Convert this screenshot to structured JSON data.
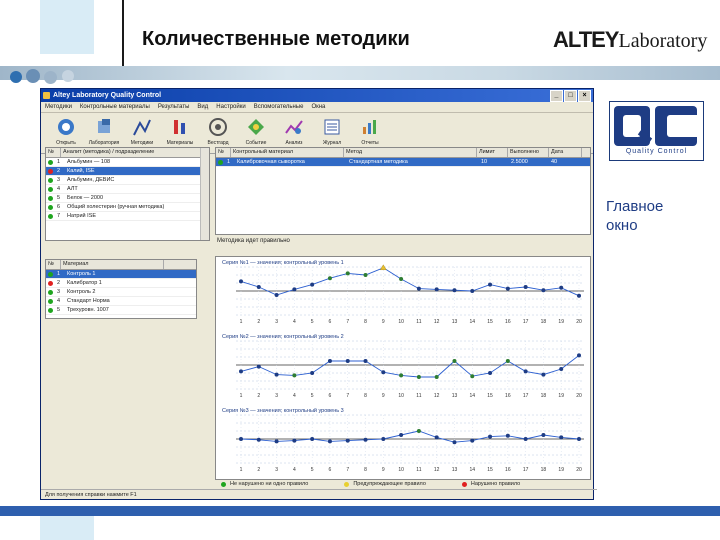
{
  "slide": {
    "title": "Количественные методики",
    "logo": {
      "main": "ALTEY",
      "sub": "Laboratory"
    },
    "side_label": [
      "Главное",
      "окно"
    ],
    "qc_badge": {
      "letters": "QC",
      "caption": "Quality Control"
    }
  },
  "window": {
    "title": "Altey Laboratory Quality Control",
    "menu": [
      "Методики",
      "Контрольные материалы",
      "Результаты",
      "Вид",
      "Настройки",
      "Вспомогательные",
      "Окна"
    ],
    "toolbar": [
      {
        "label": "Открыть",
        "icon": "open-icon"
      },
      {
        "label": "Лаборатория",
        "icon": "lab-icon"
      },
      {
        "label": "Методики",
        "icon": "method-icon"
      },
      {
        "label": "Материалы",
        "icon": "materials-icon"
      },
      {
        "label": "Вестгард",
        "icon": "westgard-icon"
      },
      {
        "label": "Событие",
        "icon": "event-icon"
      },
      {
        "label": "Анализ",
        "icon": "analysis-icon"
      },
      {
        "label": "Журнал",
        "icon": "journal-icon"
      },
      {
        "label": "Отчеты",
        "icon": "report-icon"
      }
    ]
  },
  "methods_table": {
    "headers": [
      "№",
      "Аналит (методика) / подразделение"
    ],
    "rows": [
      {
        "n": "1",
        "name": "Альбумин — 108",
        "status": "#1fa51f"
      },
      {
        "n": "2",
        "name": "Калий, ISE",
        "status": "#e02020",
        "selected": true
      },
      {
        "n": "3",
        "name": "Альбумин, ДЕВИС",
        "status": "#1fa51f"
      },
      {
        "n": "4",
        "name": "АЛТ",
        "status": "#1fa51f"
      },
      {
        "n": "5",
        "name": "Белок — 2000",
        "status": "#1fa51f"
      },
      {
        "n": "6",
        "name": "Общий холестерин (ручная методика)",
        "status": "#1fa51f"
      },
      {
        "n": "7",
        "name": "Натрий ISE",
        "status": "#1fa51f"
      }
    ]
  },
  "materials_table": {
    "headers": [
      "№",
      "Материал",
      ""
    ],
    "rows": [
      {
        "n": "1",
        "name": "Контроль 1",
        "status": "#1fa51f",
        "selected": true
      },
      {
        "n": "2",
        "name": "Калибратор 1",
        "status": "#e02020"
      },
      {
        "n": "3",
        "name": "Контроль 2",
        "status": "#1fa51f"
      },
      {
        "n": "4",
        "name": "Стандарт Норма",
        "status": "#1fa51f"
      },
      {
        "n": "5",
        "name": "Трехуровн. 1007",
        "status": "#1fa51f"
      }
    ]
  },
  "results_table": {
    "headers": [
      "№",
      "Контрольный материал",
      "Метод",
      "Лимит",
      "Выполнено",
      "Дата"
    ],
    "rows": [
      {
        "n": "1",
        "material": "Калибровочная сыворотка",
        "method": "Стандартная методика",
        "limit": "10",
        "done": "2.5000",
        "date": "40",
        "status": "#1fa51f",
        "selected": true
      }
    ]
  },
  "status_message": "Методика идет правильно",
  "charts": [
    {
      "caption": "Серия №1 — значения; контрольный уровень 1",
      "points": [
        {
          "v": 1.2,
          "c": "#1e3c84"
        },
        {
          "v": 0.5,
          "c": "#1e3c84"
        },
        {
          "v": -0.5,
          "c": "#1e3c84"
        },
        {
          "v": 0.2,
          "c": "#1e3c84"
        },
        {
          "v": 0.8,
          "c": "#1e3c84"
        },
        {
          "v": 1.6,
          "c": "#2e7d32"
        },
        {
          "v": 2.2,
          "c": "#2e7d32"
        },
        {
          "v": 2.0,
          "c": "#2e7d32"
        },
        {
          "v": 2.9,
          "c": "#e8c030"
        },
        {
          "v": 1.5,
          "c": "#2e7d32"
        },
        {
          "v": 0.3,
          "c": "#1e3c84"
        },
        {
          "v": 0.2,
          "c": "#1e3c84"
        },
        {
          "v": 0.1,
          "c": "#1e3c84"
        },
        {
          "v": 0.0,
          "c": "#1e3c84"
        },
        {
          "v": 0.8,
          "c": "#1e3c84"
        },
        {
          "v": 0.3,
          "c": "#1e3c84"
        },
        {
          "v": 0.5,
          "c": "#1e3c84"
        },
        {
          "v": 0.1,
          "c": "#1e3c84"
        },
        {
          "v": 0.4,
          "c": "#1e3c84"
        },
        {
          "v": -0.6,
          "c": "#1e3c84"
        }
      ]
    },
    {
      "caption": "Серия №2 — значения; контрольный уровень 2",
      "points": [
        {
          "v": -0.8,
          "c": "#1e3c84"
        },
        {
          "v": -0.2,
          "c": "#1e3c84"
        },
        {
          "v": -1.2,
          "c": "#1e3c84"
        },
        {
          "v": -1.3,
          "c": "#2e7d32"
        },
        {
          "v": -1.0,
          "c": "#1e3c84"
        },
        {
          "v": 0.5,
          "c": "#1e3c84"
        },
        {
          "v": 0.5,
          "c": "#1e3c84"
        },
        {
          "v": 0.5,
          "c": "#1e3c84"
        },
        {
          "v": -0.9,
          "c": "#1e3c84"
        },
        {
          "v": -1.3,
          "c": "#2e7d32"
        },
        {
          "v": -1.5,
          "c": "#2e7d32"
        },
        {
          "v": -1.5,
          "c": "#2e7d32"
        },
        {
          "v": 0.5,
          "c": "#2e7d32"
        },
        {
          "v": -1.4,
          "c": "#2e7d32"
        },
        {
          "v": -1.0,
          "c": "#1e3c84"
        },
        {
          "v": 0.5,
          "c": "#2e7d32"
        },
        {
          "v": -0.8,
          "c": "#1e3c84"
        },
        {
          "v": -1.2,
          "c": "#1e3c84"
        },
        {
          "v": -0.5,
          "c": "#1e3c84"
        },
        {
          "v": 1.2,
          "c": "#1e3c84"
        }
      ]
    },
    {
      "caption": "Серия №3 — значения; контрольный уровень 3",
      "points": [
        {
          "v": 0.0,
          "c": "#1e3c84"
        },
        {
          "v": -0.1,
          "c": "#1e3c84"
        },
        {
          "v": -0.3,
          "c": "#1e3c84"
        },
        {
          "v": -0.2,
          "c": "#1e3c84"
        },
        {
          "v": 0.0,
          "c": "#1e3c84"
        },
        {
          "v": -0.3,
          "c": "#1e3c84"
        },
        {
          "v": -0.2,
          "c": "#1e3c84"
        },
        {
          "v": -0.1,
          "c": "#1e3c84"
        },
        {
          "v": 0.0,
          "c": "#1e3c84"
        },
        {
          "v": 0.5,
          "c": "#1e3c84"
        },
        {
          "v": 1.0,
          "c": "#2e7d32"
        },
        {
          "v": 0.2,
          "c": "#1e3c84"
        },
        {
          "v": -0.4,
          "c": "#1e3c84"
        },
        {
          "v": -0.2,
          "c": "#1e3c84"
        },
        {
          "v": 0.3,
          "c": "#1e3c84"
        },
        {
          "v": 0.4,
          "c": "#1e3c84"
        },
        {
          "v": 0.0,
          "c": "#1e3c84"
        },
        {
          "v": 0.5,
          "c": "#1e3c84"
        },
        {
          "v": 0.2,
          "c": "#1e3c84"
        },
        {
          "v": 0.0,
          "c": "#1e3c84"
        }
      ]
    }
  ],
  "chart_days": [
    "1",
    "2",
    "3",
    "4",
    "5",
    "6",
    "7",
    "8",
    "9",
    "10",
    "11",
    "12",
    "13",
    "14",
    "15",
    "16",
    "17",
    "18",
    "19",
    "20"
  ],
  "legend": [
    {
      "label": "Не нарушено ни одно правило",
      "color": "#1fa51f"
    },
    {
      "label": "Предупреждающее правило",
      "color": "#e8d030"
    },
    {
      "label": "Нарушено правило",
      "color": "#e02020"
    }
  ],
  "statusbar": "Для получения справки нажмите F1"
}
